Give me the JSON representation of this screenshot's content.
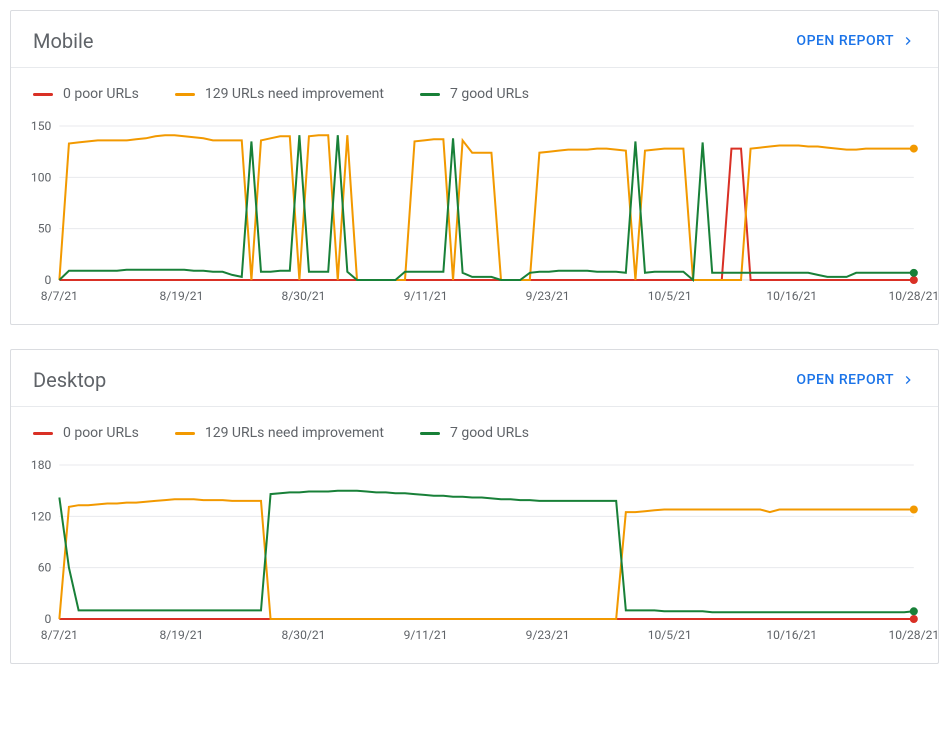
{
  "open_report_label": "OPEN REPORT",
  "mobile": {
    "title": "Mobile",
    "legend": {
      "poor": "0 poor URLs",
      "need": "129 URLs need improvement",
      "good": "7 good URLs"
    }
  },
  "desktop": {
    "title": "Desktop",
    "legend": {
      "poor": "0 poor URLs",
      "need": "129 URLs need improvement",
      "good": "7 good URLs"
    }
  },
  "chart_data": [
    {
      "panel": "mobile",
      "type": "line",
      "xlabel": "",
      "ylabel": "",
      "ylim": [
        0,
        150
      ],
      "yticks": [
        0,
        50,
        100,
        150
      ],
      "categories": [
        "8/7/21",
        "8/19/21",
        "8/30/21",
        "9/11/21",
        "9/23/21",
        "10/5/21",
        "10/16/21",
        "10/28/21"
      ],
      "x": [
        0,
        1,
        2,
        3,
        4,
        5,
        6,
        7,
        8,
        9,
        10,
        11,
        12,
        13,
        14,
        15,
        16,
        17,
        18,
        19,
        20,
        21,
        22,
        23,
        24,
        25,
        26,
        27,
        28,
        29,
        30,
        31,
        32,
        33,
        34,
        35,
        36,
        37,
        38,
        39,
        40,
        41,
        42,
        43,
        44,
        45,
        46,
        47,
        48,
        49,
        50,
        51,
        52,
        53,
        54,
        55,
        56,
        57,
        58,
        59,
        60,
        61,
        62,
        63,
        64,
        65,
        66,
        67,
        68,
        69,
        70,
        71,
        72,
        73,
        74,
        75,
        76,
        77,
        78,
        79,
        80,
        81,
        82,
        83,
        84,
        85,
        86,
        87,
        88,
        89
      ],
      "series": [
        {
          "name": "poor",
          "color": "#d93025",
          "values": [
            0,
            0,
            0,
            0,
            0,
            0,
            0,
            0,
            0,
            0,
            0,
            0,
            0,
            0,
            0,
            0,
            0,
            0,
            0,
            0,
            0,
            0,
            0,
            0,
            0,
            0,
            0,
            0,
            0,
            0,
            0,
            0,
            0,
            0,
            0,
            0,
            0,
            0,
            0,
            0,
            0,
            0,
            0,
            0,
            0,
            0,
            0,
            0,
            0,
            0,
            0,
            0,
            0,
            0,
            0,
            0,
            0,
            0,
            0,
            0,
            0,
            0,
            0,
            0,
            0,
            0,
            0,
            0,
            0,
            0,
            128,
            128,
            0,
            0,
            0,
            0,
            0,
            0,
            0,
            0,
            0,
            0,
            0,
            0,
            0,
            0,
            0,
            0,
            0,
            0
          ]
        },
        {
          "name": "need",
          "color": "#f29900",
          "values": [
            0,
            133,
            134,
            135,
            136,
            136,
            136,
            136,
            137,
            138,
            140,
            141,
            141,
            140,
            139,
            138,
            136,
            136,
            136,
            136,
            0,
            136,
            138,
            140,
            140,
            0,
            140,
            141,
            141,
            0,
            141,
            0,
            0,
            0,
            0,
            0,
            0,
            135,
            136,
            137,
            137,
            0,
            136,
            124,
            124,
            124,
            0,
            0,
            0,
            0,
            124,
            125,
            126,
            127,
            127,
            127,
            128,
            128,
            127,
            126,
            0,
            126,
            127,
            128,
            128,
            128,
            0,
            0,
            0,
            0,
            0,
            0,
            128,
            129,
            130,
            131,
            131,
            131,
            130,
            130,
            129,
            128,
            127,
            127,
            128,
            128,
            128,
            128,
            128,
            128
          ]
        },
        {
          "name": "good",
          "color": "#188038",
          "values": [
            0,
            9,
            9,
            9,
            9,
            9,
            9,
            10,
            10,
            10,
            10,
            10,
            10,
            10,
            9,
            9,
            8,
            8,
            5,
            3,
            135,
            8,
            8,
            9,
            9,
            141,
            8,
            8,
            8,
            141,
            8,
            0,
            0,
            0,
            0,
            0,
            8,
            8,
            8,
            8,
            8,
            138,
            7,
            3,
            3,
            3,
            0,
            0,
            0,
            7,
            8,
            8,
            9,
            9,
            9,
            9,
            8,
            8,
            8,
            7,
            135,
            7,
            8,
            8,
            8,
            8,
            0,
            134,
            7,
            7,
            7,
            7,
            7,
            7,
            7,
            7,
            7,
            7,
            7,
            5,
            3,
            3,
            3,
            7,
            7,
            7,
            7,
            7,
            7,
            7
          ]
        }
      ]
    },
    {
      "panel": "desktop",
      "type": "line",
      "xlabel": "",
      "ylabel": "",
      "ylim": [
        0,
        180
      ],
      "yticks": [
        0,
        60,
        120,
        180
      ],
      "categories": [
        "8/7/21",
        "8/19/21",
        "8/30/21",
        "9/11/21",
        "9/23/21",
        "10/5/21",
        "10/16/21",
        "10/28/21"
      ],
      "x": [
        0,
        1,
        2,
        3,
        4,
        5,
        6,
        7,
        8,
        9,
        10,
        11,
        12,
        13,
        14,
        15,
        16,
        17,
        18,
        19,
        20,
        21,
        22,
        23,
        24,
        25,
        26,
        27,
        28,
        29,
        30,
        31,
        32,
        33,
        34,
        35,
        36,
        37,
        38,
        39,
        40,
        41,
        42,
        43,
        44,
        45,
        46,
        47,
        48,
        49,
        50,
        51,
        52,
        53,
        54,
        55,
        56,
        57,
        58,
        59,
        60,
        61,
        62,
        63,
        64,
        65,
        66,
        67,
        68,
        69,
        70,
        71,
        72,
        73,
        74,
        75,
        76,
        77,
        78,
        79,
        80,
        81,
        82,
        83,
        84,
        85,
        86,
        87,
        88,
        89
      ],
      "series": [
        {
          "name": "poor",
          "color": "#d93025",
          "values": [
            0,
            0,
            0,
            0,
            0,
            0,
            0,
            0,
            0,
            0,
            0,
            0,
            0,
            0,
            0,
            0,
            0,
            0,
            0,
            0,
            0,
            0,
            0,
            0,
            0,
            0,
            0,
            0,
            0,
            0,
            0,
            0,
            0,
            0,
            0,
            0,
            0,
            0,
            0,
            0,
            0,
            0,
            0,
            0,
            0,
            0,
            0,
            0,
            0,
            0,
            0,
            0,
            0,
            0,
            0,
            0,
            0,
            0,
            0,
            0,
            0,
            0,
            0,
            0,
            0,
            0,
            0,
            0,
            0,
            0,
            0,
            0,
            0,
            0,
            0,
            0,
            0,
            0,
            0,
            0,
            0,
            0,
            0,
            0,
            0,
            0,
            0,
            0,
            0,
            0
          ]
        },
        {
          "name": "need",
          "color": "#f29900",
          "values": [
            0,
            131,
            133,
            133,
            134,
            135,
            135,
            136,
            136,
            137,
            138,
            139,
            140,
            140,
            140,
            139,
            139,
            139,
            138,
            138,
            138,
            138,
            0,
            0,
            0,
            0,
            0,
            0,
            0,
            0,
            0,
            0,
            0,
            0,
            0,
            0,
            0,
            0,
            0,
            0,
            0,
            0,
            0,
            0,
            0,
            0,
            0,
            0,
            0,
            0,
            0,
            0,
            0,
            0,
            0,
            0,
            0,
            0,
            0,
            125,
            125,
            126,
            127,
            128,
            128,
            128,
            128,
            128,
            128,
            128,
            128,
            128,
            128,
            128,
            125,
            128,
            128,
            128,
            128,
            128,
            128,
            128,
            128,
            128,
            128,
            128,
            128,
            128,
            128,
            128
          ]
        },
        {
          "name": "good",
          "color": "#188038",
          "values": [
            142,
            60,
            10,
            10,
            10,
            10,
            10,
            10,
            10,
            10,
            10,
            10,
            10,
            10,
            10,
            10,
            10,
            10,
            10,
            10,
            10,
            10,
            146,
            147,
            148,
            148,
            149,
            149,
            149,
            150,
            150,
            150,
            149,
            148,
            148,
            147,
            147,
            146,
            145,
            144,
            144,
            143,
            143,
            142,
            142,
            141,
            140,
            140,
            139,
            139,
            138,
            138,
            138,
            138,
            138,
            138,
            138,
            138,
            138,
            10,
            10,
            10,
            10,
            9,
            9,
            9,
            9,
            9,
            8,
            8,
            8,
            8,
            8,
            8,
            8,
            8,
            8,
            8,
            8,
            8,
            8,
            8,
            8,
            8,
            8,
            8,
            8,
            8,
            8,
            9
          ]
        }
      ]
    }
  ]
}
